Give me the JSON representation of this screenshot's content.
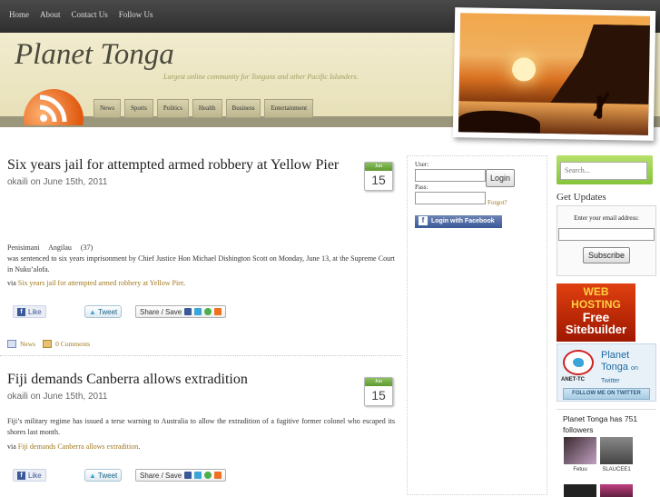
{
  "topnav": [
    "Home",
    "About",
    "Contact Us",
    "Follow Us"
  ],
  "site": {
    "title": "Planet Tonga",
    "tagline": "Largest online community for Tongans and other Pacific Islanders."
  },
  "catnav": [
    "News",
    "Sports",
    "Politics",
    "Health",
    "Business",
    "Entertainment"
  ],
  "posts": [
    {
      "title": "Six years jail for attempted armed robbery at Yellow Pier",
      "meta": "okaili on June 15th, 2011",
      "date_month": "Jun",
      "date_day": "15",
      "body": "Penisimani Angilau (37) was sentenced to six years imprisonment by Chief Justice Hon Michael Dishington Scott on Monday, June 13, at the Supreme Court in Nuku’alofa.",
      "via_prefix": "via",
      "via_link": "Six years jail for attempted armed robbery at Yellow Pier",
      "via_suffix": ".",
      "category": "News",
      "comments": "0 Comments"
    },
    {
      "title": "Fiji demands Canberra allows extradition",
      "meta": "okaili on June 15th, 2011",
      "date_month": "Jun",
      "date_day": "15",
      "body": "Fiji’s military regime has issued a terse warning to Australia to allow the extradition of a fugitive former colonel who escaped its shores last month.",
      "via_prefix": "via",
      "via_link": "Fiji demands Canberra allows extradition",
      "via_suffix": "."
    }
  ],
  "share": {
    "like": "Like",
    "tweet": "Tweet",
    "share_save": "Share / Save"
  },
  "login": {
    "user_label": "User:",
    "pass_label": "Pass:",
    "login_button": "Login",
    "forgot": "Forgot?",
    "facebook_button": "Login with Facebook"
  },
  "sidebar": {
    "search_placeholder": "Search...",
    "updates_title": "Get Updates",
    "email_prompt": "Enter your email address:",
    "subscribe_button": "Subscribe",
    "ad": {
      "line1": "WEB",
      "line2": "HOSTING",
      "line3": "Free",
      "line4": "Sitebuilder"
    },
    "twitter": {
      "name_line1": "Planet",
      "name_line2": "Tonga",
      "on": "on",
      "platform": "Twitter",
      "anet": "ANET-TC",
      "follow": "FOLLOW ME ON TWITTER"
    },
    "followers_text": "Planet Tonga has 751 followers",
    "followers": [
      "Fetuu",
      "SLAUCEE1"
    ]
  }
}
